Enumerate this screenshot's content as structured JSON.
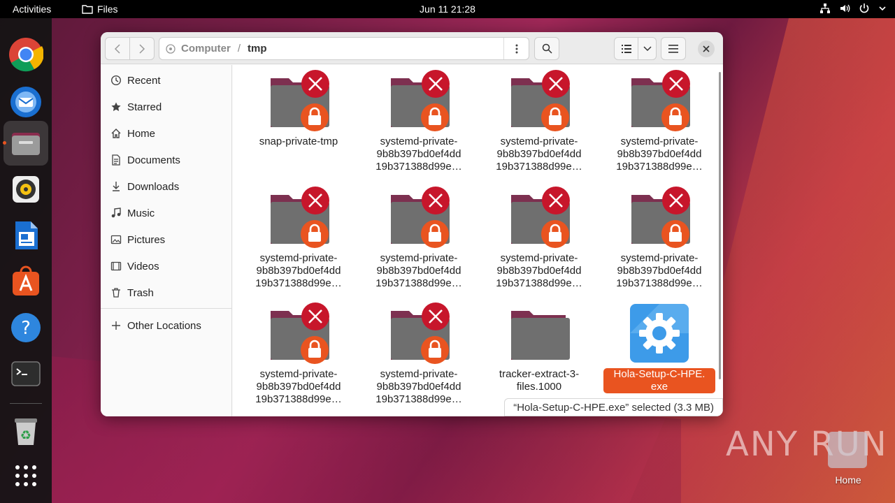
{
  "topbar": {
    "activities": "Activities",
    "app_name": "Files",
    "clock": "Jun 11  21:28"
  },
  "dock": {
    "items": [
      "chrome-icon",
      "thunderbird-icon",
      "files-icon",
      "rhythmbox-icon",
      "writer-icon",
      "app-center-icon",
      "help-icon",
      "terminal-icon",
      "trash-icon",
      "app-grid-icon"
    ]
  },
  "window": {
    "path": {
      "computer": "Computer",
      "separator": "/",
      "current": "tmp"
    },
    "sidebar": {
      "items": [
        {
          "label": "Recent",
          "icon": "clock-icon"
        },
        {
          "label": "Starred",
          "icon": "star-icon"
        },
        {
          "label": "Home",
          "icon": "home-icon"
        },
        {
          "label": "Documents",
          "icon": "document-icon"
        },
        {
          "label": "Downloads",
          "icon": "download-icon"
        },
        {
          "label": "Music",
          "icon": "music-icon"
        },
        {
          "label": "Pictures",
          "icon": "picture-icon"
        },
        {
          "label": "Videos",
          "icon": "video-icon"
        },
        {
          "label": "Trash",
          "icon": "trash-icon"
        }
      ],
      "other_locations": "Other Locations"
    },
    "files": [
      {
        "line1": "snap-private-tmp",
        "line2": "",
        "line3": "",
        "type": "locked-folder"
      },
      {
        "line1": "systemd-private-",
        "line2": "9b8b397bd0ef4dd",
        "line3": "19b371388d99e…",
        "type": "locked-folder"
      },
      {
        "line1": "systemd-private-",
        "line2": "9b8b397bd0ef4dd",
        "line3": "19b371388d99e…",
        "type": "locked-folder"
      },
      {
        "line1": "systemd-private-",
        "line2": "9b8b397bd0ef4dd",
        "line3": "19b371388d99e…",
        "type": "locked-folder"
      },
      {
        "line1": "systemd-private-",
        "line2": "9b8b397bd0ef4dd",
        "line3": "19b371388d99e…",
        "type": "locked-folder"
      },
      {
        "line1": "systemd-private-",
        "line2": "9b8b397bd0ef4dd",
        "line3": "19b371388d99e…",
        "type": "locked-folder"
      },
      {
        "line1": "systemd-private-",
        "line2": "9b8b397bd0ef4dd",
        "line3": "19b371388d99e…",
        "type": "locked-folder"
      },
      {
        "line1": "systemd-private-",
        "line2": "9b8b397bd0ef4dd",
        "line3": "19b371388d99e…",
        "type": "locked-folder"
      },
      {
        "line1": "systemd-private-",
        "line2": "9b8b397bd0ef4dd",
        "line3": "19b371388d99e…",
        "type": "locked-folder"
      },
      {
        "line1": "systemd-private-",
        "line2": "9b8b397bd0ef4dd",
        "line3": "19b371388d99e…",
        "type": "locked-folder"
      },
      {
        "line1": "tracker-extract-3-",
        "line2": "files.1000",
        "line3": "",
        "type": "folder"
      },
      {
        "line1": "Hola-Setup-C-HPE.",
        "line2": "exe",
        "line3": "",
        "type": "executable",
        "selected": true
      }
    ],
    "status": "“Hola-Setup-C-HPE.exe” selected  (3.3 MB)"
  },
  "desktop": {
    "watermark": "ANY RUN",
    "home_label": "Home"
  },
  "colors": {
    "accent": "#e95420",
    "error_red": "#c7162b",
    "folder_gray": "#6f6f6f",
    "folder_tab": "#7d3050"
  }
}
